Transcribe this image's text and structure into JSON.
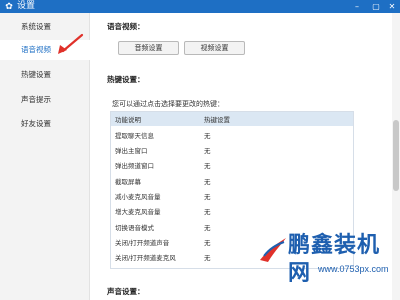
{
  "window": {
    "title": "设置"
  },
  "sidebar": {
    "items": [
      {
        "label": "系统设置",
        "active": false
      },
      {
        "label": "语音视频",
        "active": true
      },
      {
        "label": "热键设置",
        "active": false
      },
      {
        "label": "声音提示",
        "active": false
      },
      {
        "label": "好友设置",
        "active": false
      }
    ]
  },
  "voice_video": {
    "title": "语音视频：",
    "audio_button": "音频设置",
    "video_button": "视频设置"
  },
  "hotkeys": {
    "title": "热键设置：",
    "description": "您可以通过点击选择要更改的热键：",
    "columns": [
      "功能说明",
      "热键设置"
    ],
    "rows": [
      {
        "function": "提取聊天信息",
        "key": "无"
      },
      {
        "function": "弹出主窗口",
        "key": "无"
      },
      {
        "function": "弹出频道窗口",
        "key": "无"
      },
      {
        "function": "截取屏幕",
        "key": "无"
      },
      {
        "function": "减小麦克风音量",
        "key": "无"
      },
      {
        "function": "增大麦克风音量",
        "key": "无"
      },
      {
        "function": "切换语音模式",
        "key": "无"
      },
      {
        "function": "关闭/打开频道声音",
        "key": "无"
      },
      {
        "function": "关闭/打开频道麦克风",
        "key": "无"
      }
    ]
  },
  "sound": {
    "title": "声音设置："
  },
  "watermark": {
    "name": "鹏鑫装机网",
    "url": "www.0753px.com"
  },
  "colors": {
    "titlebar": "#1e6fc4",
    "active_nav_text": "#1e6fc4",
    "annotation_arrow": "#e0312a",
    "table_header": "#dbe7f3"
  }
}
